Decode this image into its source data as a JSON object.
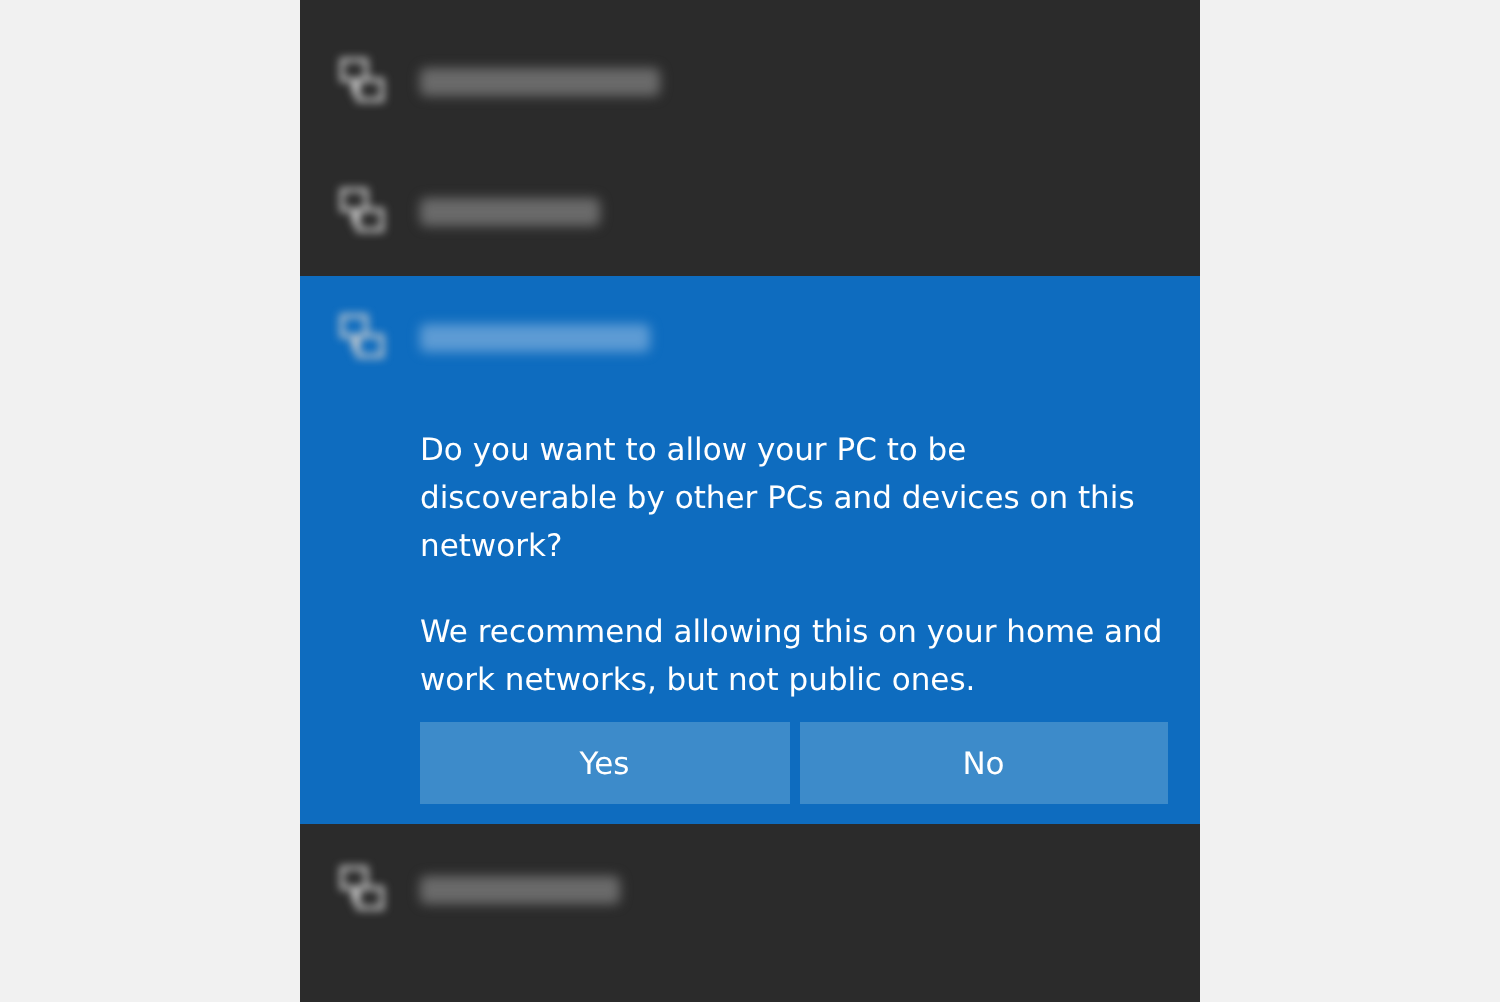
{
  "network_list": [
    {
      "selected": false
    },
    {
      "selected": false
    },
    {
      "selected": true,
      "prompt": {
        "question": "Do you want to allow your PC to be discoverable by other PCs and devices on this network?",
        "recommendation": "We recommend allowing this on your home and work networks, but not public ones.",
        "buttons": [
          "Yes",
          "No"
        ]
      }
    },
    {
      "selected": false
    }
  ]
}
